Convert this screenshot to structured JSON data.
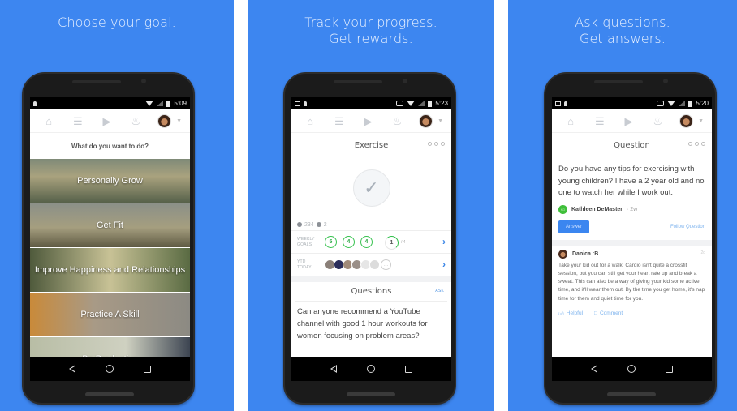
{
  "colors": {
    "background": "#3d86f0",
    "accent": "#3b86f0",
    "goal_green": "#37c24f",
    "link": "#4a90e2"
  },
  "nav_icons": [
    "home-icon",
    "list-icon",
    "megaphone-icon",
    "bell-icon",
    "avatar",
    "chevron-down-icon"
  ],
  "softkeys": [
    "back",
    "home",
    "recents"
  ],
  "panels": [
    {
      "caption": [
        "Choose your goal."
      ],
      "status": {
        "time": "5:09"
      },
      "prompt": "What do you want to do?",
      "goals": [
        "Personally Grow",
        "Get Fit",
        "Improve Happiness and Relationships",
        "Practice A Skill",
        "Be Productive"
      ]
    },
    {
      "caption": [
        "Track your progress.",
        "Get rewards."
      ],
      "status": {
        "time": "5:23"
      },
      "title": "Exercise",
      "check_count": "234",
      "badge_count": "2",
      "weekly_goals": {
        "label": "WEEKLY GOALS",
        "values": [
          "5",
          "4",
          "4"
        ],
        "current": "1",
        "of_total": "/ 4",
        "current_progress": 0.25
      },
      "today": {
        "label": "YTD TODAY",
        "more": "..."
      },
      "questions": {
        "title": "Questions",
        "ask_label": "ASK",
        "first_question": "Can anyone recommend a YouTube channel with good 1 hour workouts for women focusing on problem areas?"
      }
    },
    {
      "caption": [
        "Ask questions.",
        "Get answers."
      ],
      "status": {
        "time": "5:20"
      },
      "title": "Question",
      "question": "Do you have any tips for exercising with young children? I have a 2 year old and no one to watch her while I work out.",
      "asker": {
        "initials": "KD",
        "name": "Kathleen DeMaster",
        "time": "· 2w"
      },
      "answer_button": "Answer",
      "follow_link": "Follow Question",
      "answer": {
        "name": "Danica :B",
        "time": "2d",
        "body": "Take your kid out for a walk. Cardio isn't quite a crossfit session, but you can still get your heart rate up and break a sweat. This can also be a way of giving your kid some active time, and it'll wear them out. By the time you get home, it's nap time for them and quiet time for you.",
        "helpful_label": "Helpful",
        "comment_label": "Comment"
      }
    }
  ]
}
